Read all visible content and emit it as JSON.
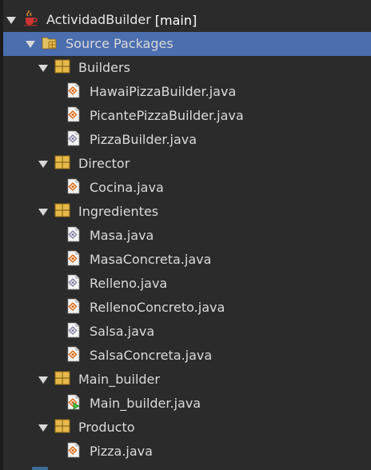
{
  "project": {
    "name": "ActividadBuilder",
    "branch": "[main]",
    "icon": "java-coffee-cup-icon"
  },
  "source_packages": {
    "label": "Source Packages",
    "icon": "source-packages-folder-icon",
    "selected": true
  },
  "packages": [
    {
      "name": "Builders",
      "icon": "package-icon",
      "files": [
        {
          "name": "HawaiPizzaBuilder.java",
          "icon": "java-class-icon"
        },
        {
          "name": "PicantePizzaBuilder.java",
          "icon": "java-class-icon"
        },
        {
          "name": "PizzaBuilder.java",
          "icon": "java-interface-icon"
        }
      ]
    },
    {
      "name": "Director",
      "icon": "package-icon",
      "files": [
        {
          "name": "Cocina.java",
          "icon": "java-class-icon"
        }
      ]
    },
    {
      "name": "Ingredientes",
      "icon": "package-icon",
      "files": [
        {
          "name": "Masa.java",
          "icon": "java-interface-icon"
        },
        {
          "name": "MasaConcreta.java",
          "icon": "java-class-icon"
        },
        {
          "name": "Relleno.java",
          "icon": "java-interface-icon"
        },
        {
          "name": "RellenoConcreto.java",
          "icon": "java-class-icon"
        },
        {
          "name": "Salsa.java",
          "icon": "java-interface-icon"
        },
        {
          "name": "SalsaConcreta.java",
          "icon": "java-class-icon"
        }
      ]
    },
    {
      "name": "Main_builder",
      "icon": "package-icon",
      "files": [
        {
          "name": "Main_builder.java",
          "icon": "java-main-class-icon"
        }
      ]
    },
    {
      "name": "Producto",
      "icon": "package-icon",
      "files": [
        {
          "name": "Pizza.java",
          "icon": "java-class-icon"
        }
      ]
    }
  ],
  "colors": {
    "background": "#2b2b2b",
    "selection": "#4b6eaf",
    "text": "#dadada",
    "package_icon": "#e8b84a"
  }
}
